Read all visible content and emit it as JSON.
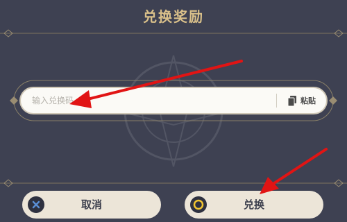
{
  "dialog": {
    "title": "兑换奖励"
  },
  "code_input": {
    "placeholder": "输入兑换码",
    "value": ""
  },
  "paste_button": {
    "label": "粘贴",
    "icon": "paste-icon"
  },
  "cancel_button": {
    "label": "取消",
    "icon": "cross-icon"
  },
  "confirm_button": {
    "label": "兑换",
    "icon": "circle-icon"
  },
  "colors": {
    "background": "#3e4152",
    "title": "#d9c08a",
    "button": "#ece5d8",
    "annotation_arrow": "#e11414",
    "confirm_glyph": "#f2c531",
    "cancel_glyph": "#5a8fd6"
  },
  "annotations": [
    {
      "type": "arrow",
      "target": "code-input",
      "color": "red"
    },
    {
      "type": "arrow",
      "target": "confirm-button",
      "color": "red"
    }
  ]
}
